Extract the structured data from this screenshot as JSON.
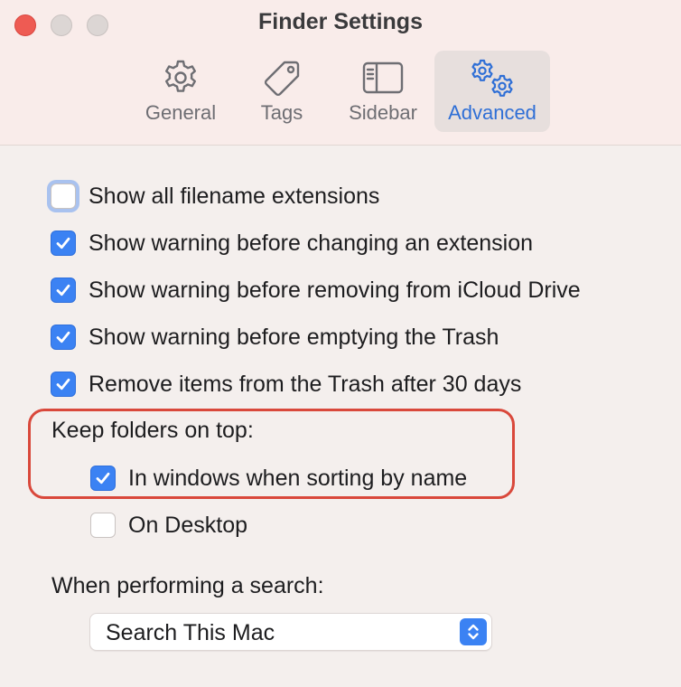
{
  "window": {
    "title": "Finder Settings"
  },
  "tabs": [
    {
      "label": "General",
      "icon": "gear-icon",
      "selected": false
    },
    {
      "label": "Tags",
      "icon": "tag-icon",
      "selected": false
    },
    {
      "label": "Sidebar",
      "icon": "sidebar-icon",
      "selected": false
    },
    {
      "label": "Advanced",
      "icon": "gears-icon",
      "selected": true
    }
  ],
  "options": {
    "show_extensions": {
      "label": "Show all filename extensions",
      "checked": false
    },
    "warn_extension_change": {
      "label": "Show warning before changing an extension",
      "checked": true
    },
    "warn_icloud_remove": {
      "label": "Show warning before removing from iCloud Drive",
      "checked": true
    },
    "warn_empty_trash": {
      "label": "Show warning before emptying the Trash",
      "checked": true
    },
    "remove_trash_30_days": {
      "label": "Remove items from the Trash after 30 days",
      "checked": true
    }
  },
  "folders_on_top": {
    "heading": "Keep folders on top:",
    "in_windows": {
      "label": "In windows when sorting by name",
      "checked": true
    },
    "on_desktop": {
      "label": "On Desktop",
      "checked": false
    }
  },
  "search": {
    "heading": "When performing a search:",
    "selected_value": "Search This Mac"
  },
  "colors": {
    "accent": "#3b82f3",
    "highlight_border": "#d9483b",
    "selected_tab_text": "#2f6fd6"
  }
}
